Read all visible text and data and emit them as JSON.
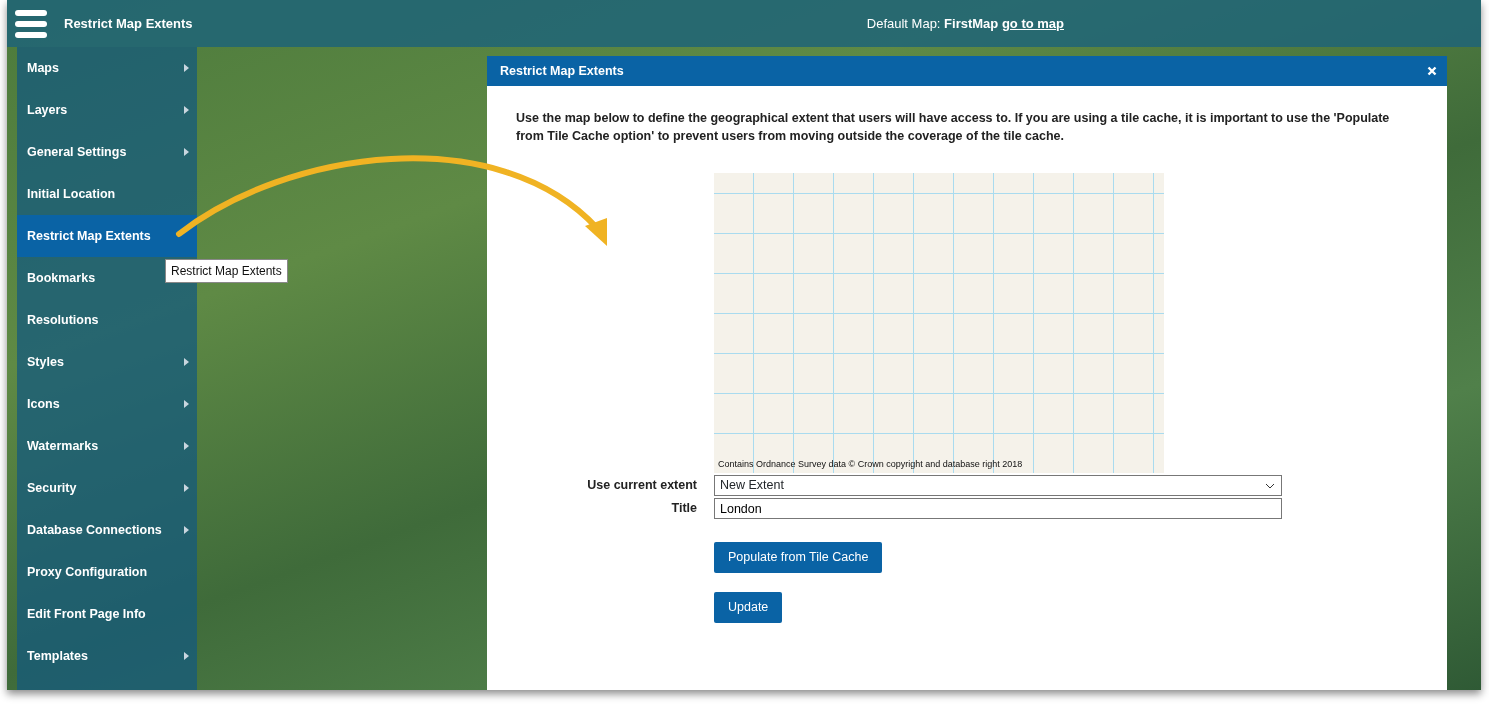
{
  "header": {
    "title": "Restrict Map Extents",
    "default_map_label": "Default Map:",
    "default_map_name": "FirstMap",
    "go_to_map_link": "go to map"
  },
  "sidebar": {
    "items": [
      {
        "label": "Maps",
        "has_submenu": true,
        "selected": false
      },
      {
        "label": "Layers",
        "has_submenu": true,
        "selected": false
      },
      {
        "label": "General Settings",
        "has_submenu": true,
        "selected": false
      },
      {
        "label": "Initial Location",
        "has_submenu": false,
        "selected": false
      },
      {
        "label": "Restrict Map Extents",
        "has_submenu": false,
        "selected": true
      },
      {
        "label": "Bookmarks",
        "has_submenu": false,
        "selected": false
      },
      {
        "label": "Resolutions",
        "has_submenu": false,
        "selected": false
      },
      {
        "label": "Styles",
        "has_submenu": true,
        "selected": false
      },
      {
        "label": "Icons",
        "has_submenu": true,
        "selected": false
      },
      {
        "label": "Watermarks",
        "has_submenu": true,
        "selected": false
      },
      {
        "label": "Security",
        "has_submenu": true,
        "selected": false
      },
      {
        "label": "Database Connections",
        "has_submenu": true,
        "selected": false
      },
      {
        "label": "Proxy Configuration",
        "has_submenu": false,
        "selected": false
      },
      {
        "label": "Edit Front Page Info",
        "has_submenu": false,
        "selected": false
      },
      {
        "label": "Templates",
        "has_submenu": true,
        "selected": false
      }
    ]
  },
  "tooltip": "Restrict Map Extents",
  "dialog": {
    "title": "Restrict Map Extents",
    "description": "Use the map below to define the geographical extent that users will have access to. If you are using a tile cache, it is important to use the 'Populate from Tile Cache option' to prevent users from moving outside the coverage of the tile cache.",
    "map": {
      "attribution": "Contains Ordnance Survey data © Crown copyright and database right 2018"
    },
    "fields": [
      {
        "kind": "select",
        "label": "Use current extent",
        "value": "New Extent"
      },
      {
        "kind": "text",
        "label": "Title",
        "value": "London"
      }
    ],
    "buttons": [
      "Populate from Tile Cache",
      "Update"
    ]
  }
}
